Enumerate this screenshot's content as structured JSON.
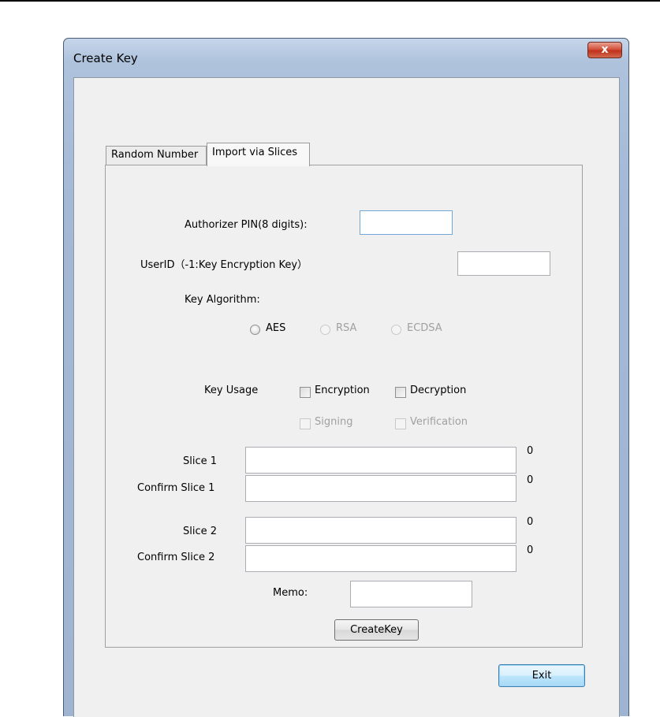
{
  "window": {
    "title": "Create Key",
    "close_glyph": "x"
  },
  "tabs": [
    {
      "label": "Random Number",
      "active": false
    },
    {
      "label": "Import via Slices",
      "active": true
    }
  ],
  "form": {
    "authorizer_pin_label": "Authorizer PIN(8 digits):",
    "authorizer_pin_value": "",
    "user_id_label": "UserID（-1:Key Encryption Key）",
    "user_id_value": "",
    "key_algorithm_label": "Key Algorithm:",
    "algorithms": [
      {
        "label": "AES",
        "enabled": true
      },
      {
        "label": "RSA",
        "enabled": false
      },
      {
        "label": "ECDSA",
        "enabled": false
      }
    ],
    "key_usage_label": "Key Usage",
    "usages": [
      {
        "label": "Encryption",
        "enabled": true,
        "checked": false
      },
      {
        "label": "Decryption",
        "enabled": true,
        "checked": false
      },
      {
        "label": "Signing",
        "enabled": false,
        "checked": false
      },
      {
        "label": "Verification",
        "enabled": false,
        "checked": false
      }
    ],
    "slices": [
      {
        "label": "Slice 1",
        "value": "",
        "count": "0"
      },
      {
        "label": "Confirm Slice 1",
        "value": "",
        "count": "0"
      },
      {
        "label": "Slice 2",
        "value": "",
        "count": "0"
      },
      {
        "label": "Confirm Slice 2",
        "value": "",
        "count": "0"
      }
    ],
    "memo_label": "Memo:",
    "memo_value": "",
    "create_key_button": "CreateKey"
  },
  "exit_button": "Exit",
  "icons": {
    "close": "close-icon",
    "radio": "radio-icon",
    "checkbox": "checkbox-icon"
  }
}
